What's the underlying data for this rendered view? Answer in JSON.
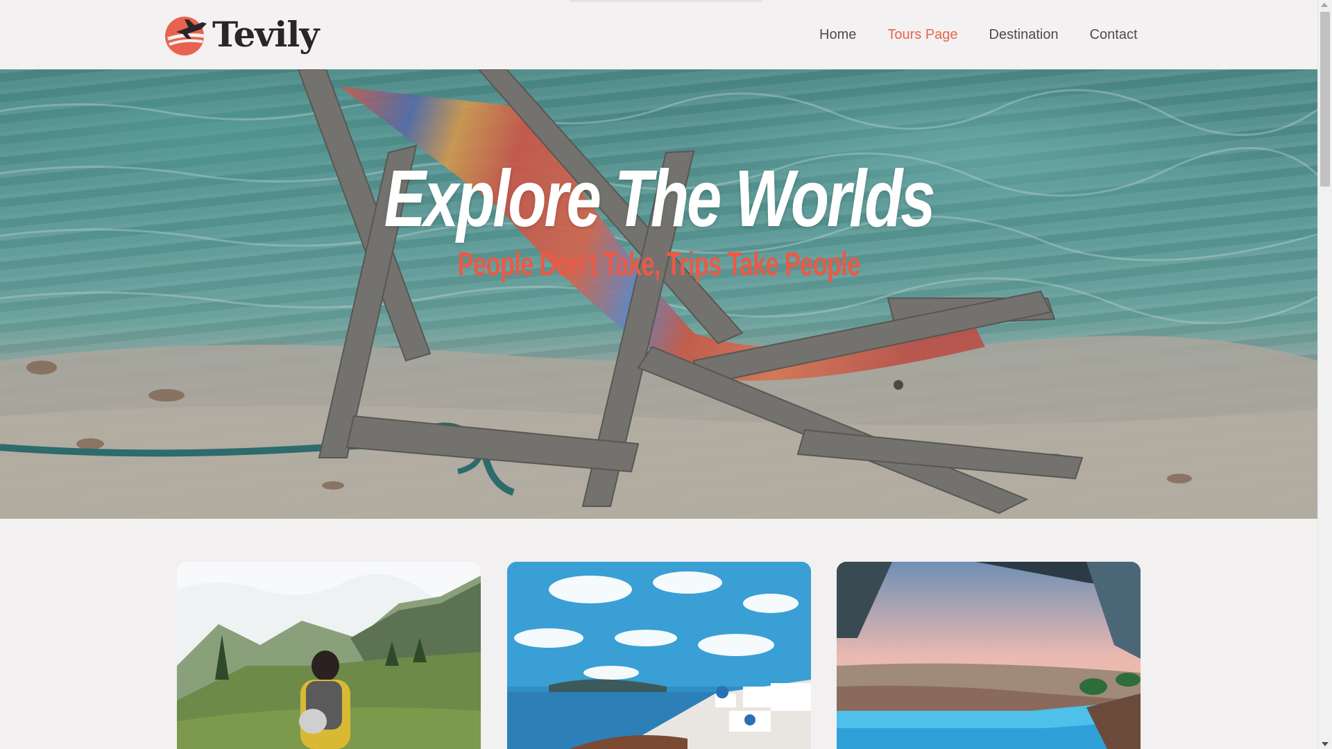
{
  "brand": {
    "name": "Tevily",
    "logo_icon": "airplane-circle-icon",
    "accent_color": "#e8634f",
    "text_color": "#2a2528"
  },
  "nav": {
    "items": [
      {
        "label": "Home",
        "active": false
      },
      {
        "label": "Tours Page",
        "active": true
      },
      {
        "label": "Destination",
        "active": false
      },
      {
        "label": "Contact",
        "active": false
      }
    ]
  },
  "hero": {
    "title": "Explore The Worlds",
    "subtitle": "People Don't Take, Trips Take People",
    "title_color": "#ffffff",
    "subtitle_color": "#ea5a47"
  },
  "tours": {
    "cards": [
      {
        "image": "hiker-in-mountain-valley"
      },
      {
        "image": "santorini-coastline"
      },
      {
        "image": "infinity-pool-sunset"
      }
    ]
  }
}
